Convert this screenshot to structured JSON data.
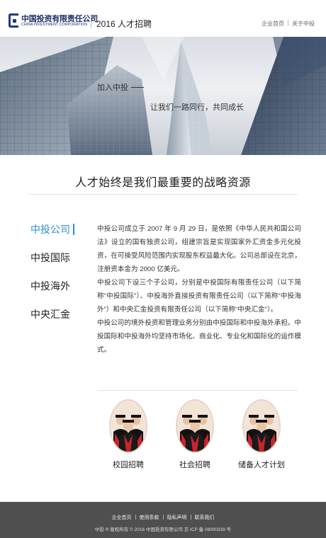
{
  "header": {
    "logo_cn": "中国投资有限责任公司",
    "logo_en": "CHINA INVESTMENT CORPORATION",
    "title": "2016 人才招聘",
    "nav": [
      "企业首页",
      "关于中投"
    ]
  },
  "banner": {
    "line1": "加入中投",
    "line2": "让我们一路同行，共同成长"
  },
  "slogan": "人才始终是我们最重要的战略资源",
  "sidenav": {
    "items": [
      "中投公司",
      "中投国际",
      "中投海外",
      "中央汇金"
    ],
    "active_index": 0
  },
  "content": {
    "paragraphs": [
      "中投公司成立于 2007 年 9 月 29 日，是依照《中华人民共和国公司法》设立的国有独资公司，组建宗旨是实现国家外汇资金多元化投资，在可接受风险范围内实现股东权益最大化。公司总部设在北京，注册资本金为 2000 亿美元。",
      "中投公司下设三个子公司，分别是中投国际有限责任公司（以下简称“中投国际”）、中投海外直接投资有限责任公司（以下简称“中投海外”）和中央汇金投资有限责任公司（以下简称“中央汇金”）。",
      "中投公司的境外投资和管理业务分别由中投国际和中投海外承担。中投国际和中投海外均坚持市场化、商业化、专业化和国际化的运作模式。"
    ]
  },
  "cards": [
    {
      "label": "校园招聘"
    },
    {
      "label": "社会招聘"
    },
    {
      "label": "储备人才计划"
    }
  ],
  "footer": {
    "links": [
      "企业首页",
      "使用条款",
      "隐私声明",
      "联系我们"
    ],
    "copyright": "中投 ® 版权所有 © 2016 中国投资有限公司 京 ICP 备 08000339 号"
  },
  "colors": {
    "accent": "#2a8fd0",
    "brand": "#1d2f66",
    "footer_bg": "#4f4f4f"
  }
}
